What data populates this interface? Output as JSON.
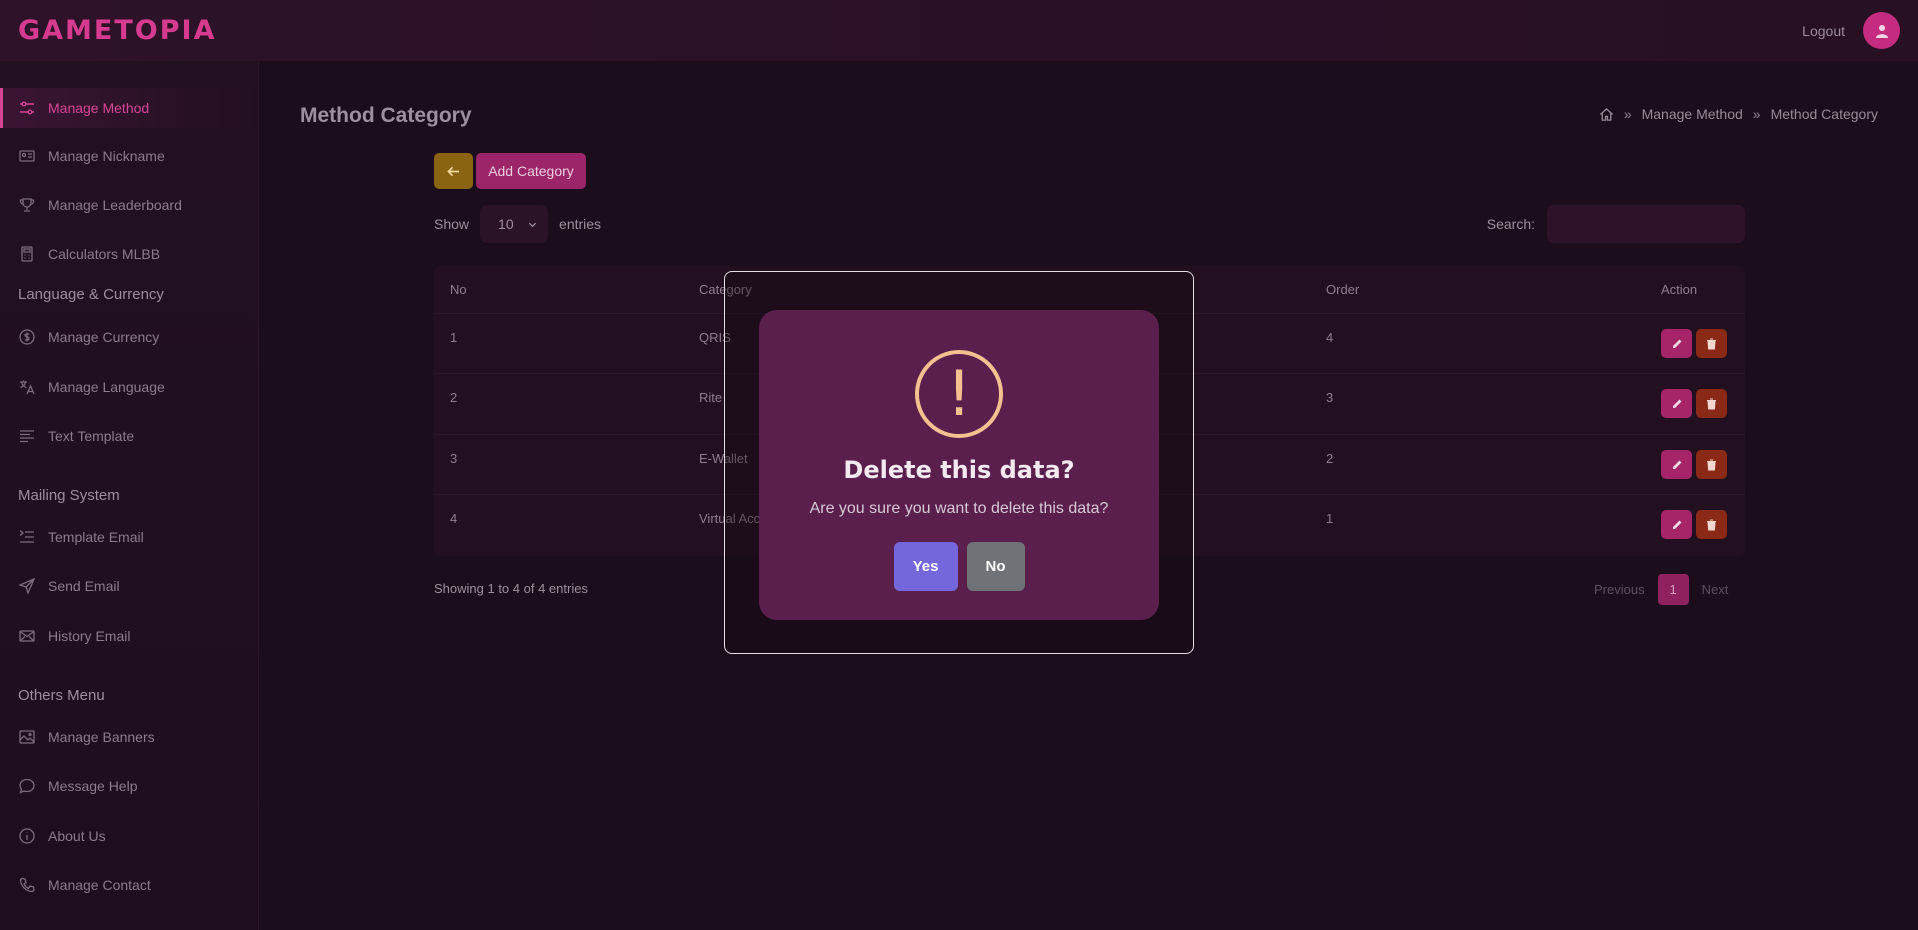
{
  "app": {
    "logo": "GAMETOPIA",
    "logout_label": "Logout"
  },
  "sidebar": {
    "items": [
      {
        "label": "Manage Method",
        "icon": "sliders-icon",
        "active": true
      },
      {
        "label": "Manage Nickname",
        "icon": "id-card-icon"
      },
      {
        "label": "Manage Leaderboard",
        "icon": "trophy-icon"
      },
      {
        "label": "Calculators MLBB",
        "icon": "calculator-icon"
      },
      {
        "label": "Manage Currency",
        "icon": "dollar-circle-icon"
      },
      {
        "label": "Manage Language",
        "icon": "translate-icon"
      },
      {
        "label": "Text Template",
        "icon": "align-left-icon"
      },
      {
        "label": "Template Email",
        "icon": "indent-icon"
      },
      {
        "label": "Send Email",
        "icon": "send-icon"
      },
      {
        "label": "History Email",
        "icon": "mail-icon"
      },
      {
        "label": "Manage Banners",
        "icon": "image-icon"
      },
      {
        "label": "Message Help",
        "icon": "chat-icon"
      },
      {
        "label": "About Us",
        "icon": "info-icon"
      },
      {
        "label": "Manage Contact",
        "icon": "phone-icon"
      }
    ],
    "sections": [
      "Language & Currency",
      "Mailing System",
      "Others Menu"
    ]
  },
  "page": {
    "title": "Method Category",
    "breadcrumb": [
      "Manage Method",
      "Method Category"
    ],
    "add_button": "Add Category",
    "show_label": "Show",
    "entries_value": "10",
    "entries_label": "entries",
    "search_label": "Search:",
    "table": {
      "headers": {
        "no": "No",
        "category": "Category",
        "order": "Order",
        "action": "Action"
      },
      "rows": [
        {
          "no": "1",
          "category": "QRIS",
          "order": "4"
        },
        {
          "no": "2",
          "category": "Rite",
          "order": "3"
        },
        {
          "no": "3",
          "category": "E-Wallet",
          "order": "2"
        },
        {
          "no": "4",
          "category": "Virtual Acc",
          "order": "1"
        }
      ]
    },
    "footer_info": "Showing 1 to 4 of 4 entries",
    "pager": {
      "previous": "Previous",
      "current": "1",
      "next": "Next"
    }
  },
  "modal": {
    "icon_glyph": "!",
    "title": "Delete this data?",
    "text": "Are you sure you want to delete this data?",
    "yes": "Yes",
    "no": "No"
  },
  "colors": {
    "accent": "#d94596",
    "background": "#1c0d1c",
    "modal": "#5a1f4d"
  }
}
